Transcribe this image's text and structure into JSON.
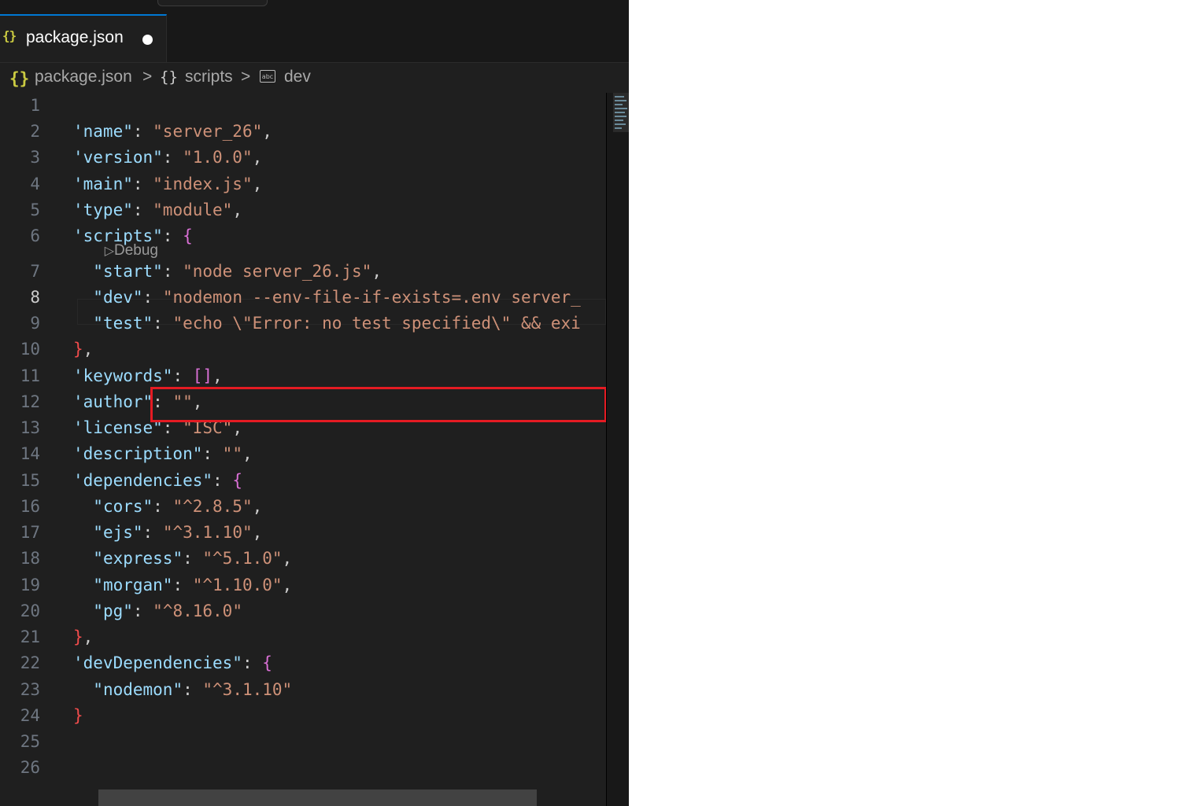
{
  "tab": {
    "icon": "json-file-icon",
    "filename": "package.json",
    "modified_indicator": "unsaved-dot"
  },
  "breadcrumb": {
    "file": "package.json",
    "sep": ">",
    "obj_brace": "{}",
    "section": "scripts",
    "key_icon": "abc",
    "key": "dev"
  },
  "codelens": {
    "label": "Debug"
  },
  "editor": {
    "active_line": 8,
    "lines": [
      {
        "n": "1",
        "tokens": []
      },
      {
        "n": "2",
        "tokens": [
          [
            "k",
            "'name\""
          ],
          [
            "p",
            ": "
          ],
          [
            "s",
            "\"server_26\""
          ],
          [
            "p",
            ","
          ]
        ]
      },
      {
        "n": "3",
        "tokens": [
          [
            "k",
            "'version\""
          ],
          [
            "p",
            ": "
          ],
          [
            "s",
            "\"1.0.0\""
          ],
          [
            "p",
            ","
          ]
        ]
      },
      {
        "n": "4",
        "tokens": [
          [
            "k",
            "'main\""
          ],
          [
            "p",
            ": "
          ],
          [
            "s",
            "\"index.js\""
          ],
          [
            "p",
            ","
          ]
        ]
      },
      {
        "n": "5",
        "tokens": [
          [
            "k",
            "'type\""
          ],
          [
            "p",
            ": "
          ],
          [
            "s",
            "\"module\""
          ],
          [
            "p",
            ","
          ]
        ]
      },
      {
        "n": "6",
        "tokens": [
          [
            "k",
            "'scripts\""
          ],
          [
            "p",
            ": "
          ],
          [
            "b1",
            "{"
          ]
        ]
      },
      {
        "n": "7",
        "tokens": [
          [
            "p",
            "  "
          ],
          [
            "k",
            "\"start\""
          ],
          [
            "p",
            ": "
          ],
          [
            "s",
            "\"node server_26.js\""
          ],
          [
            "p",
            ","
          ]
        ]
      },
      {
        "n": "8",
        "tokens": [
          [
            "p",
            "  "
          ],
          [
            "k",
            "\"dev\""
          ],
          [
            "p",
            ": "
          ],
          [
            "s",
            "\"nodemon --env-file-if-exists=.env server_"
          ]
        ]
      },
      {
        "n": "9",
        "tokens": [
          [
            "p",
            "  "
          ],
          [
            "k",
            "\"test\""
          ],
          [
            "p",
            ": "
          ],
          [
            "s",
            "\"echo \\\"Error: no test specified\\\" && exi"
          ]
        ]
      },
      {
        "n": "10",
        "tokens": [
          [
            "bred",
            "}"
          ],
          [
            "p",
            ","
          ]
        ]
      },
      {
        "n": "11",
        "tokens": [
          [
            "k",
            "'keywords\""
          ],
          [
            "p",
            ": "
          ],
          [
            "b1",
            "[]"
          ],
          [
            "p",
            ","
          ]
        ]
      },
      {
        "n": "12",
        "tokens": [
          [
            "k",
            "'author\""
          ],
          [
            "p",
            ": "
          ],
          [
            "s",
            "\"\""
          ],
          [
            "p",
            ","
          ]
        ]
      },
      {
        "n": "13",
        "tokens": [
          [
            "k",
            "'license\""
          ],
          [
            "p",
            ": "
          ],
          [
            "s",
            "\"ISC\""
          ],
          [
            "p",
            ","
          ]
        ]
      },
      {
        "n": "14",
        "tokens": [
          [
            "k",
            "'description\""
          ],
          [
            "p",
            ": "
          ],
          [
            "s",
            "\"\""
          ],
          [
            "p",
            ","
          ]
        ]
      },
      {
        "n": "15",
        "tokens": [
          [
            "k",
            "'dependencies\""
          ],
          [
            "p",
            ": "
          ],
          [
            "b1",
            "{"
          ]
        ]
      },
      {
        "n": "16",
        "tokens": [
          [
            "p",
            "  "
          ],
          [
            "k",
            "\"cors\""
          ],
          [
            "p",
            ": "
          ],
          [
            "s",
            "\"^2.8.5\""
          ],
          [
            "p",
            ","
          ]
        ]
      },
      {
        "n": "17",
        "tokens": [
          [
            "p",
            "  "
          ],
          [
            "k",
            "\"ejs\""
          ],
          [
            "p",
            ": "
          ],
          [
            "s",
            "\"^3.1.10\""
          ],
          [
            "p",
            ","
          ]
        ]
      },
      {
        "n": "18",
        "tokens": [
          [
            "p",
            "  "
          ],
          [
            "k",
            "\"express\""
          ],
          [
            "p",
            ": "
          ],
          [
            "s",
            "\"^5.1.0\""
          ],
          [
            "p",
            ","
          ]
        ]
      },
      {
        "n": "19",
        "tokens": [
          [
            "p",
            "  "
          ],
          [
            "k",
            "\"morgan\""
          ],
          [
            "p",
            ": "
          ],
          [
            "s",
            "\"^1.10.0\""
          ],
          [
            "p",
            ","
          ]
        ]
      },
      {
        "n": "20",
        "tokens": [
          [
            "p",
            "  "
          ],
          [
            "k",
            "\"pg\""
          ],
          [
            "p",
            ": "
          ],
          [
            "s",
            "\"^8.16.0\""
          ]
        ]
      },
      {
        "n": "21",
        "tokens": [
          [
            "bred",
            "}"
          ],
          [
            "p",
            ","
          ]
        ]
      },
      {
        "n": "22",
        "tokens": [
          [
            "k",
            "'devDependencies\""
          ],
          [
            "p",
            ": "
          ],
          [
            "b1",
            "{"
          ]
        ]
      },
      {
        "n": "23",
        "tokens": [
          [
            "p",
            "  "
          ],
          [
            "k",
            "\"nodemon\""
          ],
          [
            "p",
            ": "
          ],
          [
            "s",
            "\"^3.1.10\""
          ]
        ]
      },
      {
        "n": "24",
        "tokens": [
          [
            "bred",
            "}"
          ]
        ]
      },
      {
        "n": "25",
        "tokens": []
      },
      {
        "n": "26",
        "tokens": []
      }
    ]
  },
  "annotation": {
    "highlight": "red-rectangle",
    "color": "#e51b23"
  },
  "colors": {
    "editor_bg": "#1f1f1f",
    "key": "#9cdcfe",
    "string": "#ce9178",
    "bracket": "#da70d6",
    "json_icon": "#cbcb41"
  }
}
